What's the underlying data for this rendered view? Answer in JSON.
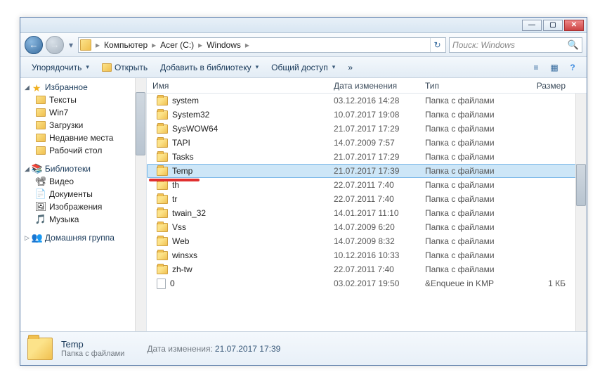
{
  "titlebar": {
    "min": "—",
    "max": "▢",
    "close": "✕"
  },
  "nav": {
    "back": "←",
    "forward": "→",
    "drop": "▾",
    "refresh": "↻"
  },
  "address": {
    "segments": [
      "Компьютер",
      "Acer (C:)",
      "Windows"
    ],
    "sep": "▸"
  },
  "search": {
    "placeholder": "Поиск: Windows",
    "icon": "🔍"
  },
  "toolbar": {
    "organize": "Упорядочить",
    "open": "Открыть",
    "addlib": "Добавить в библиотеку",
    "share": "Общий доступ",
    "drop": "▾",
    "view_icon": "≡",
    "help_icon": "?"
  },
  "sidebar": {
    "favorites": {
      "label": "Избранное",
      "star": "★"
    },
    "fav_items": [
      {
        "label": "Тексты"
      },
      {
        "label": "Win7"
      },
      {
        "label": "Загрузки"
      },
      {
        "label": "Недавние места"
      },
      {
        "label": "Рабочий стол"
      }
    ],
    "libraries": {
      "label": "Библиотеки"
    },
    "lib_items": [
      {
        "icon": "📽",
        "label": "Видео"
      },
      {
        "icon": "📄",
        "label": "Документы"
      },
      {
        "icon": "🖼",
        "label": "Изображения"
      },
      {
        "icon": "🎵",
        "label": "Музыка"
      }
    ],
    "homegroup": {
      "icon": "👥",
      "label": "Домашняя группа"
    }
  },
  "columns": {
    "name": "Имя",
    "date": "Дата изменения",
    "type": "Тип",
    "size": "Размер"
  },
  "files": [
    {
      "name": "system",
      "date": "03.12.2016 14:28",
      "type": "Папка с файлами",
      "size": "",
      "kind": "folder"
    },
    {
      "name": "System32",
      "date": "10.07.2017 19:08",
      "type": "Папка с файлами",
      "size": "",
      "kind": "folder"
    },
    {
      "name": "SysWOW64",
      "date": "21.07.2017 17:29",
      "type": "Папка с файлами",
      "size": "",
      "kind": "folder"
    },
    {
      "name": "TAPI",
      "date": "14.07.2009 7:57",
      "type": "Папка с файлами",
      "size": "",
      "kind": "folder"
    },
    {
      "name": "Tasks",
      "date": "21.07.2017 17:29",
      "type": "Папка с файлами",
      "size": "",
      "kind": "folder"
    },
    {
      "name": "Temp",
      "date": "21.07.2017 17:39",
      "type": "Папка с файлами",
      "size": "",
      "kind": "folder",
      "selected": true
    },
    {
      "name": "th",
      "date": "22.07.2011 7:40",
      "type": "Папка с файлами",
      "size": "",
      "kind": "folder"
    },
    {
      "name": "tr",
      "date": "22.07.2011 7:40",
      "type": "Папка с файлами",
      "size": "",
      "kind": "folder"
    },
    {
      "name": "twain_32",
      "date": "14.01.2017 11:10",
      "type": "Папка с файлами",
      "size": "",
      "kind": "folder"
    },
    {
      "name": "Vss",
      "date": "14.07.2009 6:20",
      "type": "Папка с файлами",
      "size": "",
      "kind": "folder"
    },
    {
      "name": "Web",
      "date": "14.07.2009 8:32",
      "type": "Папка с файлами",
      "size": "",
      "kind": "folder"
    },
    {
      "name": "winsxs",
      "date": "10.12.2016 10:33",
      "type": "Папка с файлами",
      "size": "",
      "kind": "folder"
    },
    {
      "name": "zh-tw",
      "date": "22.07.2011 7:40",
      "type": "Папка с файлами",
      "size": "",
      "kind": "folder"
    },
    {
      "name": "0",
      "date": "03.02.2017 19:50",
      "type": "&Enqueue in KMP",
      "size": "1 КБ",
      "kind": "file"
    }
  ],
  "details": {
    "name": "Temp",
    "type": "Папка с файлами",
    "date_label": "Дата изменения:",
    "date_value": "21.07.2017 17:39"
  }
}
